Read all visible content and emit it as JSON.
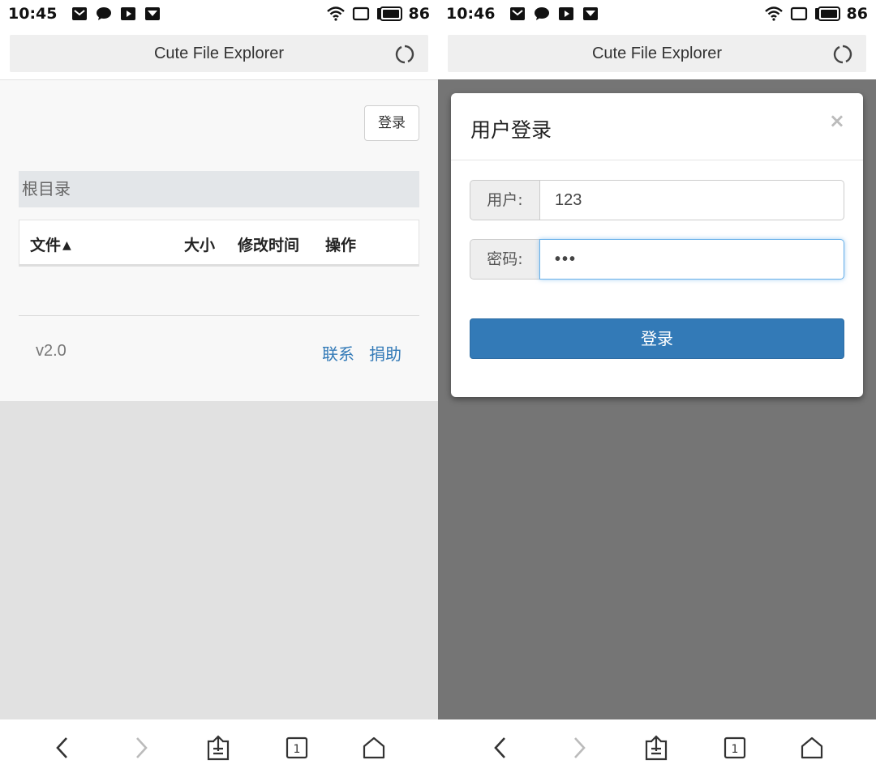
{
  "left": {
    "status": {
      "time": "10:45",
      "battery": "86"
    },
    "browser_title": "Cute File Explorer",
    "login_button": "登录",
    "breadcrumb": "根目录",
    "table": {
      "columns": [
        "文件",
        "大小",
        "修改时间",
        "操作"
      ],
      "sort_indicator": "▲"
    },
    "footer": {
      "version": "v2.0",
      "links": [
        "联系",
        "捐助"
      ]
    }
  },
  "right": {
    "status": {
      "time": "10:46",
      "battery": "86"
    },
    "browser_title": "Cute File Explorer",
    "modal": {
      "title": "用户登录",
      "close": "×",
      "user_label": "用户:",
      "user_value": "123",
      "password_label": "密码:",
      "password_value": "•••",
      "submit": "登录"
    }
  },
  "colors": {
    "link": "#337ab7",
    "primary_button": "#337ab7",
    "overlay": "#757575",
    "focus_border": "#66afe9"
  },
  "icons": [
    "gmail-icon",
    "chat-bubble-icon",
    "play-icon",
    "image-icon",
    "wifi-icon",
    "screen-rotate-icon",
    "battery-icon",
    "refresh-icon",
    "back-icon",
    "forward-icon",
    "share-icon",
    "tabs-icon",
    "home-icon"
  ]
}
